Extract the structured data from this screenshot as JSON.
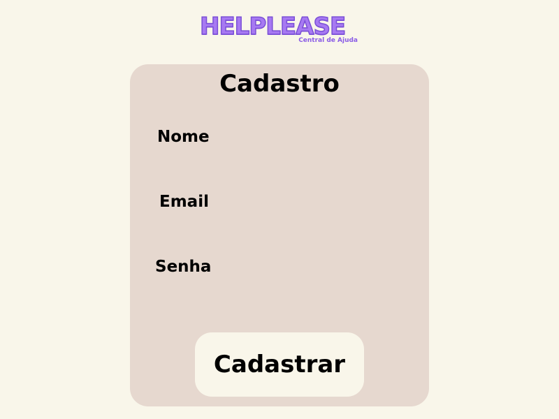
{
  "logo": {
    "title": "HELPLEASE",
    "subtitle": "Central de Ajuda"
  },
  "form": {
    "title": "Cadastro",
    "fields": [
      {
        "label": "Nome",
        "value": "",
        "placeholder": ""
      },
      {
        "label": "Email",
        "value": "",
        "placeholder": ""
      },
      {
        "label": "Senha",
        "value": "",
        "placeholder": ""
      }
    ],
    "submit_label": "Cadastrar"
  },
  "colors": {
    "background": "#f9f6ea",
    "card": "#e6d8cf",
    "brand": "#a779f2",
    "text": "#000000"
  }
}
